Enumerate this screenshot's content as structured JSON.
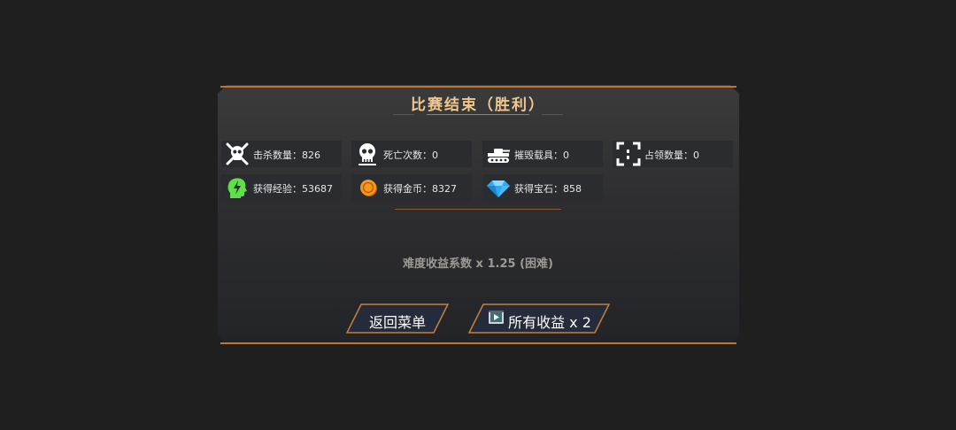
{
  "dialog": {
    "title": "比赛结束（胜利）",
    "difficulty_text": "难度收益系数 x 1.25 (困难)"
  },
  "stats": [
    {
      "icon": "skull-crossbones-icon",
      "label": "击杀数量：826"
    },
    {
      "icon": "skull-icon",
      "label": "死亡次数：0"
    },
    {
      "icon": "tank-icon",
      "label": "摧毁载具：0"
    },
    {
      "icon": "capture-frame-icon",
      "label": "占领数量：0"
    },
    {
      "icon": "experience-head-icon",
      "label": "获得经验：53687"
    },
    {
      "icon": "gold-coin-icon",
      "label": "获得金币：8327"
    },
    {
      "icon": "diamond-icon",
      "label": "获得宝石：858"
    }
  ],
  "buttons": {
    "back_menu": "返回菜单",
    "double_rewards": "所有收益 x 2",
    "double_rewards_icon": "video-ad-icon"
  },
  "colors": {
    "accent": "#c4742c",
    "title": "#f0c88f",
    "background": "#1f1f20"
  }
}
